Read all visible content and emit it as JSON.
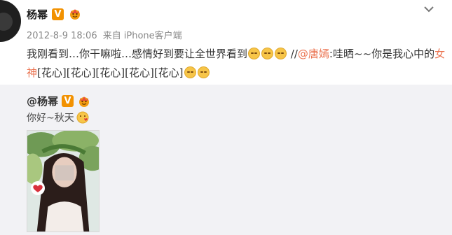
{
  "post": {
    "username": "杨幂",
    "verified_badge": "V",
    "timestamp": "2012-8-9 18:06",
    "source_prefix": "来自",
    "source": "iPhone客户端",
    "text_part1": "我刚看到…你干嘛啦…感情好到要让全世界看到",
    "separator": "//",
    "mention": "@唐嫣",
    "text_part2": ":哇晒~~你是我心中的",
    "highlight_word": "女神",
    "hearts": "[花心][花心][花心][花心][花心]"
  },
  "repost": {
    "username": "@杨幂",
    "text": "你好~秋天"
  },
  "icons": {
    "verified": "verified-v-icon",
    "crown": "crown-icon",
    "more": "chevron-down-icon",
    "emoji": "smile-emoji-icon",
    "heart": "heart-icon"
  },
  "colors": {
    "link": "#eb7350",
    "badge": "#f29100",
    "repost_bg": "#f2f2f5"
  }
}
